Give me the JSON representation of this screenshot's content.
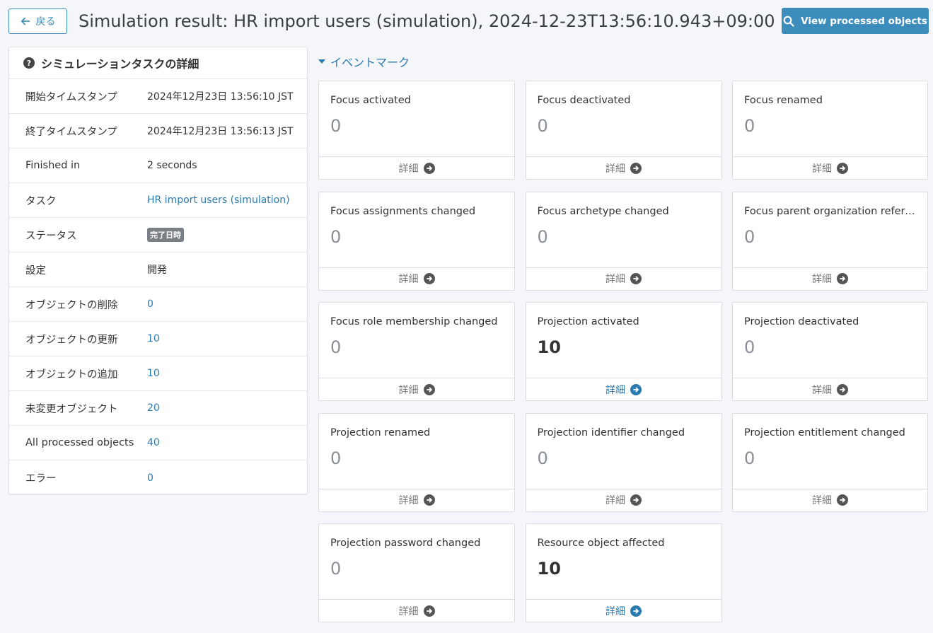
{
  "header": {
    "back_label": "戻る",
    "title": "Simulation result: HR import users (simulation), 2024-12-23T13:56:10.943+09:00",
    "view_button_label": "View processed objects"
  },
  "details": {
    "title": "シミュレーションタスクの詳細",
    "rows": [
      {
        "label": "開始タイムスタンプ",
        "value": "2024年12月23日 13:56:10 JST"
      },
      {
        "label": "終了タイムスタンプ",
        "value": "2024年12月23日 13:56:13 JST"
      },
      {
        "label": "Finished in",
        "value": "2 seconds"
      },
      {
        "label": "タスク",
        "value": "HR import users (simulation)"
      },
      {
        "label": "ステータス",
        "value": "完了日時"
      },
      {
        "label": "設定",
        "value": "開発"
      },
      {
        "label": "オブジェクトの削除",
        "value": "0"
      },
      {
        "label": "オブジェクトの更新",
        "value": "10"
      },
      {
        "label": "オブジェクトの追加",
        "value": "10"
      },
      {
        "label": "未変更オブジェクト",
        "value": "20"
      },
      {
        "label": "All processed objects",
        "value": "40"
      },
      {
        "label": "エラー",
        "value": "0"
      }
    ]
  },
  "event_marks": {
    "title": "イベントマーク",
    "details_label": "詳細",
    "cards": [
      {
        "title": "Focus activated",
        "value": "0"
      },
      {
        "title": "Focus deactivated",
        "value": "0"
      },
      {
        "title": "Focus renamed",
        "value": "0"
      },
      {
        "title": "Focus assignments changed",
        "value": "0"
      },
      {
        "title": "Focus archetype changed",
        "value": "0"
      },
      {
        "title": "Focus parent organization referen…",
        "value": "0"
      },
      {
        "title": "Focus role membership changed",
        "value": "0"
      },
      {
        "title": "Projection activated",
        "value": "10"
      },
      {
        "title": "Projection deactivated",
        "value": "0"
      },
      {
        "title": "Projection renamed",
        "value": "0"
      },
      {
        "title": "Projection identifier changed",
        "value": "0"
      },
      {
        "title": "Projection entitlement changed",
        "value": "0"
      },
      {
        "title": "Projection password changed",
        "value": "0"
      },
      {
        "title": "Resource object affected",
        "value": "10"
      }
    ]
  },
  "colors": {
    "accent": "#3c8dbc",
    "link": "#2a7ab0",
    "background": "#f4f6f9"
  }
}
